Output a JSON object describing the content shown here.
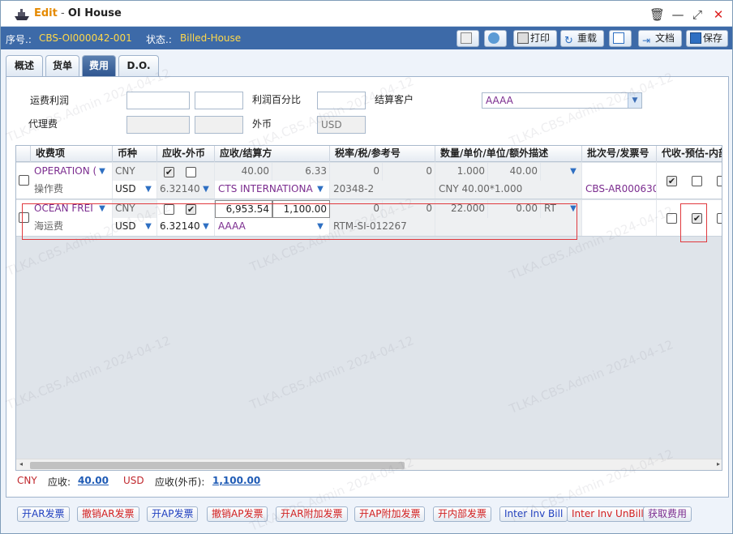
{
  "titlebar": {
    "edit": "Edit",
    "sep": " - ",
    "title": "OI House"
  },
  "info": {
    "no_label": "序号.:",
    "no_value": "CBS-OI000042-001",
    "status_label": "状态.:",
    "status_value": "Billed-House"
  },
  "toolbar": {
    "print": "打印",
    "reload": "重载",
    "doc": "文档",
    "save": "保存"
  },
  "tabs": [
    "概述",
    "货单",
    "费用",
    "D.O."
  ],
  "form": {
    "freight_profit_label": "运费利润",
    "profit_pct_label": "利润百分比",
    "settle_customer_label": "结算客户",
    "settle_customer_value": "AAAA",
    "agent_fee_label": "代理费",
    "foreign_currency_label": "外币",
    "foreign_currency_value": "USD"
  },
  "grid": {
    "headers": [
      "收费项",
      "币种",
      "应收-外币",
      "应收/结算方",
      "税率/税/参考号",
      "数量/单价/单位/额外描述",
      "批次号/发票号",
      "代收-预估-内部"
    ],
    "rows": [
      {
        "item": "OPERATION (",
        "item2": "操作费",
        "cur": "CNY",
        "cur2": "USD",
        "rate": "6.32140",
        "amt1": "40.00",
        "amt2": "6.33",
        "party": "CTS INTERNATIONA",
        "tax": "0",
        "tax2": "0",
        "ref": "20348-2",
        "qty": "1.000",
        "price": "40.00",
        "desc": "CNY 40.00*1.000",
        "invoice": "CBS-AR000630"
      },
      {
        "item": "OCEAN FREI",
        "item2": "海运费",
        "cur": "CNY",
        "cur2": "USD",
        "rate": "6.32140",
        "amt1": "6,953.54",
        "amt2": "1,100.00",
        "party": "AAAA",
        "tax": "0",
        "tax2": "0",
        "ref": "RTM-SI-012267",
        "qty": "22.000",
        "price": "0.00",
        "unit": "RT",
        "invoice": ""
      }
    ]
  },
  "summary": {
    "cur1": "CNY",
    "recv_label": "应收:",
    "recv_value": "40.00",
    "cur2": "USD",
    "recv_fc_label": "应收(外币):",
    "recv_fc_value": "1,100.00"
  },
  "buttons": [
    {
      "label": "开AR发票",
      "color": "#1f3fbf"
    },
    {
      "label": "撤销AR发票",
      "color": "#d21f1f"
    },
    {
      "label": "开AP发票",
      "color": "#1f3fbf"
    },
    {
      "label": "撤销AP发票",
      "color": "#d21f1f"
    },
    {
      "label": "开AR附加发票",
      "color": "#d21f1f"
    },
    {
      "label": "开AP附加发票",
      "color": "#d21f1f"
    },
    {
      "label": "开内部发票",
      "color": "#d21f1f"
    },
    {
      "label": "Inter Inv Bill",
      "color": "#1f3fbf"
    },
    {
      "label": "Inter Inv UnBill",
      "color": "#d21f1f"
    },
    {
      "label": "获取费用",
      "color": "#7b2c8f"
    }
  ],
  "watermark": "TLKA.CBS.Admin 2024-04-12",
  "colors": {
    "accent": "#3d6aa8",
    "status": "#ffd84a",
    "highlight": "#e0393e"
  }
}
